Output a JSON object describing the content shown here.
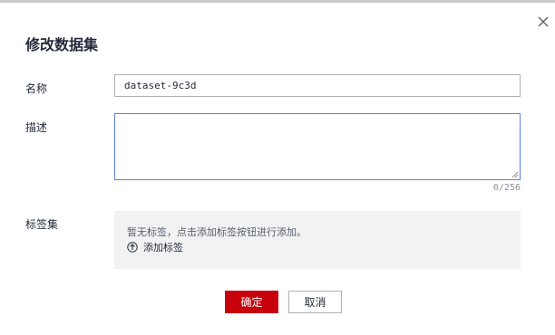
{
  "dialog": {
    "title": "修改数据集",
    "close_icon": "close-icon"
  },
  "form": {
    "name_label": "名称",
    "name_value": "dataset-9c3d",
    "description_label": "描述",
    "description_value": "",
    "description_counter": "0/256",
    "tags_label": "标签集",
    "tags_hint": "暂无标签，点击添加标签按钮进行添加。",
    "add_tag_label": "添加标签",
    "add_tag_icon": "plus-circle-icon"
  },
  "footer": {
    "ok_label": "确定",
    "cancel_label": "取消"
  },
  "colors": {
    "primary": "#c7000b",
    "focus_border": "#5e7ce0",
    "tag_area_bg": "#f2f2f2"
  }
}
